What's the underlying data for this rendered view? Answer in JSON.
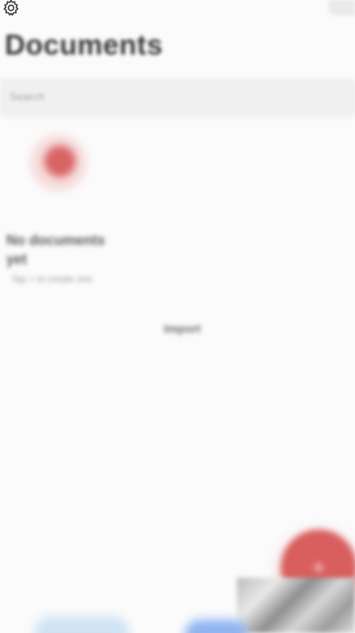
{
  "header": {
    "title": "Documents",
    "settings_icon": "gear-icon"
  },
  "search": {
    "placeholder": "Search"
  },
  "empty_state": {
    "icon": "document-icon",
    "title": "No documents yet",
    "subtitle": "Tap + to create one",
    "action_label": "Import"
  },
  "fab": {
    "icon": "plus-icon",
    "label": "+"
  },
  "colors": {
    "accent": "#d95f5f",
    "background": "#fbfbfb",
    "title": "#3a3a3a"
  }
}
